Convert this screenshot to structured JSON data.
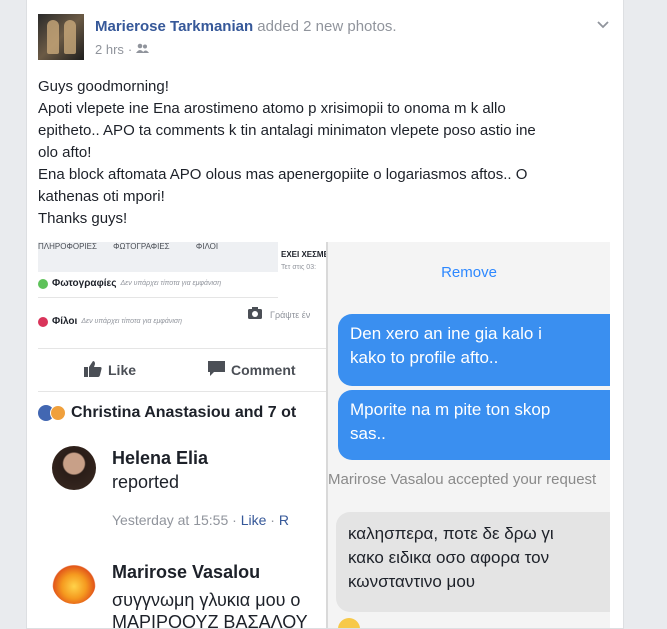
{
  "post": {
    "author": "Marierose Tarkmanian",
    "action": "added 2 new photos.",
    "time": "2 hrs",
    "lines": [
      "Guys goodmorning!",
      "Apoti vlepete ine Ena arostimeno atomo p xrisimopii to onoma m k allo",
      "epitheto.. APO ta comments k tin antalagi minimaton vlepete poso astio ine",
      "olo afto!",
      "Ena block aftomata APO olous mas apenergopiite o logariasmos aftos.. O",
      "kathenas oti mpori!",
      "Thanks guys!"
    ]
  },
  "left_shot": {
    "tabs": [
      "ΠΛΗΡΟΦΟΡΙΕΣ",
      "ΦΩΤΟΓΡΑΦΙΕΣ",
      "ΦΙΛΟΙ"
    ],
    "side_text": "ΕΧΕΙ ΧΕΣΜΕ",
    "side_sub": "Τετ στις 03:",
    "row1_title": "Φωτογραφίες",
    "row1_sub": "Δεν υπάρχει τίποτα για εμφάνιση",
    "row2_title": "Φίλοι",
    "row2_sub": "Δεν υπάρχει τίποτα για εμφάνιση",
    "write_placeholder": "Γράψτε έν",
    "like": "Like",
    "comment": "Comment",
    "reactions": "Christina Anastasiou and 7 ot",
    "comments": [
      {
        "name": "Helena Elia",
        "text": "reported",
        "time": "Yesterday at 15:55",
        "like": "Like",
        "reply": "R"
      },
      {
        "name": "Marirose Vasalou",
        "text": "συγγνωμη γλυκια μου ο",
        "text2": "ΜΑΡΙΡΟΟΥΖ ΒΑΣΑΛΟΥ"
      }
    ]
  },
  "right_shot": {
    "remove": "Remove",
    "bubble1": [
      "Den xero an ine gia kalo i",
      "kako to profile afto.."
    ],
    "bubble2": [
      "Mporite na m pite ton skop",
      "sas.."
    ],
    "accepted": "Marirose Vasalou accepted your request",
    "gbubble": [
      "καλησπερα, ποτε δε δρω γι",
      "κακο ειδικα οσο αφορα τον",
      "κωνσταντινο μου"
    ]
  },
  "colors": {
    "link": "#365899",
    "messenger_blue": "#3a8ff0",
    "remove": "#2d88ff"
  }
}
